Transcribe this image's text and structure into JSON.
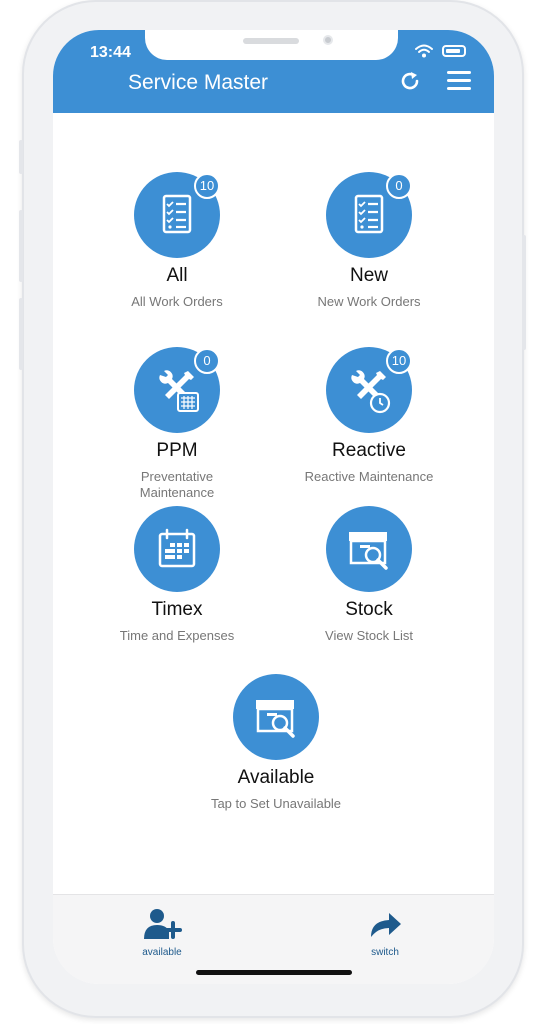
{
  "status_bar": {
    "time": "13:44"
  },
  "header": {
    "title": "Service Master"
  },
  "tiles": [
    {
      "title": "All",
      "subtitle": "All Work Orders",
      "badge": "10",
      "icon": "checklist-icon"
    },
    {
      "title": "New",
      "subtitle": "New Work Orders",
      "badge": "0",
      "icon": "checklist-icon"
    },
    {
      "title": "PPM",
      "subtitle": "Preventative Maintenance",
      "badge": "0",
      "icon": "tools-calendar-icon"
    },
    {
      "title": "Reactive",
      "subtitle": "Reactive Maintenance",
      "badge": "10",
      "icon": "tools-clock-icon"
    },
    {
      "title": "Timex",
      "subtitle": "Time and Expenses",
      "icon": "calendar-icon"
    },
    {
      "title": "Stock",
      "subtitle": "View Stock List",
      "icon": "box-search-icon"
    },
    {
      "title": "Available",
      "subtitle": "Tap to Set Unavailable",
      "icon": "box-search-icon"
    }
  ],
  "bottom_bar": {
    "items": [
      {
        "label": "available",
        "icon": "add-user-icon"
      },
      {
        "label": "switch",
        "icon": "share-arrow-icon"
      }
    ]
  },
  "colors": {
    "accent": "#3d8fd4",
    "bottom_label": "#1e5a8c"
  }
}
